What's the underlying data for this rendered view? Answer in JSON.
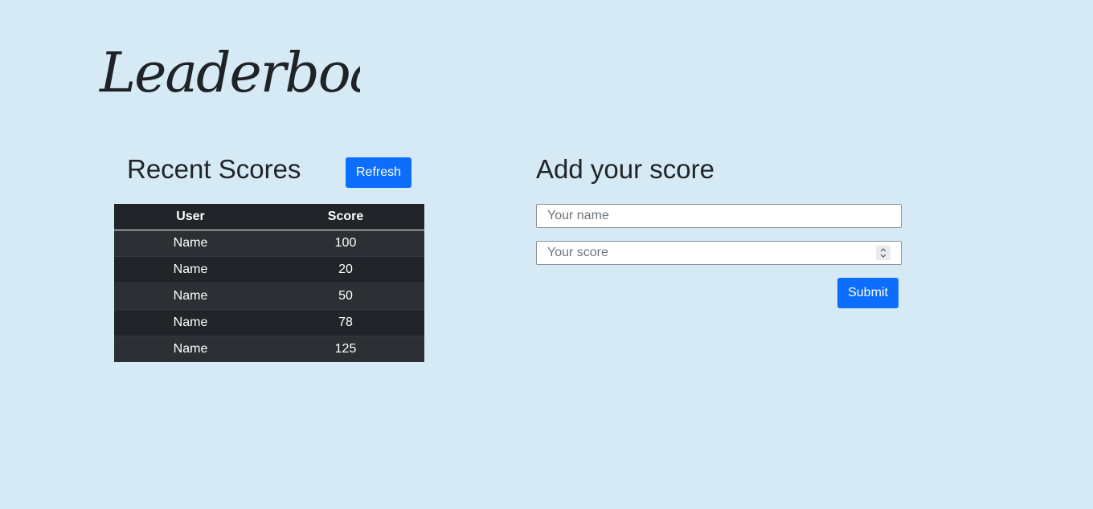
{
  "logo": {
    "text": "Leaderboard"
  },
  "recent": {
    "title": "Recent Scores",
    "refresh_label": "Refresh",
    "columns": [
      "User",
      "Score"
    ],
    "rows": [
      {
        "user": "Name",
        "score": "100"
      },
      {
        "user": "Name",
        "score": "20"
      },
      {
        "user": "Name",
        "score": "50"
      },
      {
        "user": "Name",
        "score": "78"
      },
      {
        "user": "Name",
        "score": "125"
      }
    ]
  },
  "form": {
    "title": "Add your score",
    "name_value": "",
    "name_placeholder": "Your name",
    "score_value": "",
    "score_placeholder": "Your score",
    "submit_label": "Submit"
  },
  "colors": {
    "background": "#d5eaf5",
    "primary_button": "#0d6efd",
    "table_dark": "#212529",
    "table_stripe": "#2c3034"
  },
  "icons": {
    "score_spinner": "spinner-updown-icon"
  }
}
